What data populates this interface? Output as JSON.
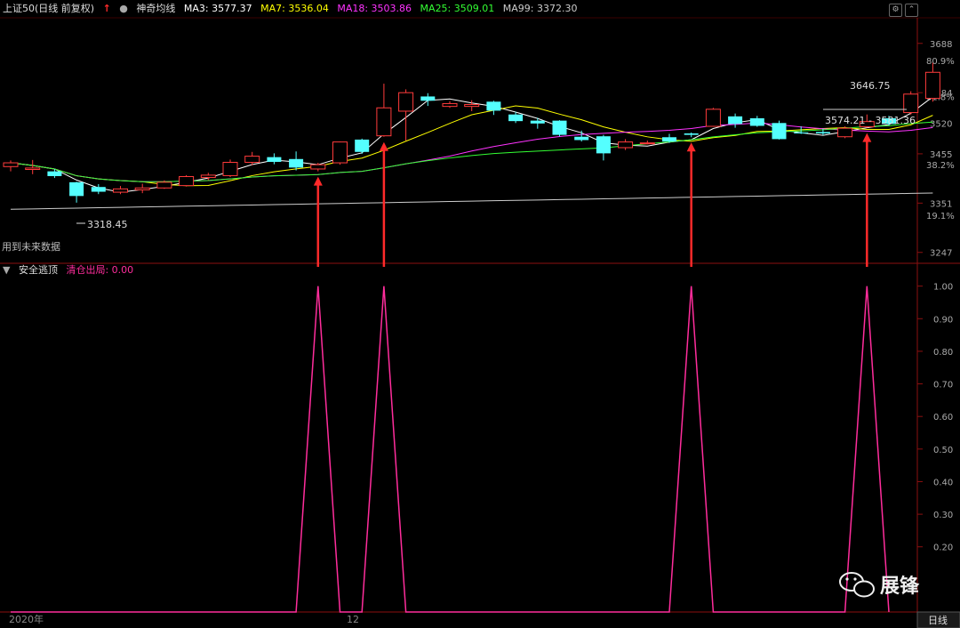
{
  "header": {
    "symbol": "上证50(日线 前复权)",
    "indicator": "神奇均线",
    "ma": [
      {
        "label": "MA3: 3577.37",
        "color": "#ffffff"
      },
      {
        "label": "MA7: 3536.04",
        "color": "#ffff00"
      },
      {
        "label": "MA18: 3503.86",
        "color": "#ff33ff"
      },
      {
        "label": "MA25: 3509.01",
        "color": "#33ff33"
      },
      {
        "label": "MA99: 3372.30",
        "color": "#cccccc"
      }
    ]
  },
  "sub_header": {
    "title": "安全逃顶",
    "series": "清仓出局: 0.00"
  },
  "footer": {
    "year": "2020年",
    "month": "12",
    "period": "日线"
  },
  "watermark": {
    "text": "展锋"
  },
  "annotations": {
    "future": "用到未来数据",
    "low": "3318.45",
    "high": "3646.75",
    "range": "3574.21 - 3581.36"
  },
  "chart_data": [
    {
      "type": "candlestick",
      "y_ticks": [
        "3688",
        "3584",
        "3520",
        "3455",
        "3351",
        "3247"
      ],
      "y_ticks_values": [
        3688,
        3584,
        3520,
        3455,
        3351,
        3247
      ],
      "pct_ticks": [
        "80.9%",
        "61.8%",
        "38.2%",
        "19.1%"
      ],
      "pct_values": [
        3651.8,
        3576.2,
        3432.7,
        3324.9
      ],
      "ylim": [
        3224,
        3742
      ],
      "candles": [
        [
          3428,
          3436,
          3418,
          3441
        ],
        [
          3422,
          3425,
          3412,
          3442
        ],
        [
          3418,
          3408,
          3404,
          3423
        ],
        [
          3395,
          3366,
          3352,
          3396
        ],
        [
          3385,
          3375,
          3370,
          3391
        ],
        [
          3374,
          3381,
          3370,
          3387
        ],
        [
          3379,
          3383,
          3372,
          3392
        ],
        [
          3383,
          3395,
          3381,
          3399
        ],
        [
          3388,
          3407,
          3386,
          3410
        ],
        [
          3405,
          3410,
          3399,
          3415
        ],
        [
          3409,
          3437,
          3406,
          3443
        ],
        [
          3437,
          3450,
          3431,
          3459
        ],
        [
          3448,
          3438,
          3433,
          3456
        ],
        [
          3444,
          3426,
          3420,
          3460
        ],
        [
          3423,
          3432,
          3418,
          3436
        ],
        [
          3436,
          3480,
          3432,
          3481
        ],
        [
          3485,
          3459,
          3455,
          3487
        ],
        [
          3493,
          3552,
          3491,
          3603
        ],
        [
          3545,
          3584,
          3483,
          3591
        ],
        [
          3576,
          3567,
          3556,
          3583
        ],
        [
          3555,
          3561,
          3552,
          3566
        ],
        [
          3555,
          3559,
          3545,
          3568
        ],
        [
          3565,
          3546,
          3537,
          3567
        ],
        [
          3538,
          3524,
          3520,
          3544
        ],
        [
          3525,
          3519,
          3508,
          3531
        ],
        [
          3525,
          3495,
          3492,
          3526
        ],
        [
          3491,
          3484,
          3481,
          3504
        ],
        [
          3492,
          3456,
          3441,
          3495
        ],
        [
          3468,
          3480,
          3463,
          3486
        ],
        [
          3478,
          3478,
          3475,
          3483
        ],
        [
          3490,
          3481,
          3478,
          3497
        ],
        [
          3498,
          3495,
          3490,
          3500
        ],
        [
          3513,
          3549,
          3512,
          3552
        ],
        [
          3534,
          3518,
          3510,
          3540
        ],
        [
          3530,
          3514,
          3512,
          3535
        ],
        [
          3520,
          3486,
          3485,
          3525
        ],
        [
          3500,
          3498,
          3497,
          3513
        ],
        [
          3501,
          3498,
          3494,
          3508
        ],
        [
          3491,
          3509,
          3488,
          3513
        ],
        [
          3512,
          3523,
          3510,
          3538
        ],
        [
          3530,
          3518,
          3515,
          3535
        ],
        [
          3542,
          3581,
          3538,
          3587
        ],
        [
          3572,
          3627,
          3565,
          3647
        ]
      ]
    },
    {
      "type": "line",
      "title": "安全逃顶",
      "series": [
        {
          "name": "清仓出局",
          "values": [
            0,
            0,
            0,
            0,
            0,
            0,
            0,
            0,
            0,
            0,
            0,
            0,
            0,
            0,
            1,
            0,
            0,
            1,
            0,
            0,
            0,
            0,
            0,
            0,
            0,
            0,
            0,
            0,
            0,
            0,
            0,
            1,
            0,
            0,
            0,
            0,
            0,
            0,
            0,
            1,
            0
          ]
        }
      ],
      "y_ticks": [
        "1.00",
        "0.90",
        "0.80",
        "0.70",
        "0.60",
        "0.50",
        "0.40",
        "0.30",
        "0.20"
      ],
      "y_ticks_values": [
        1.0,
        0.9,
        0.8,
        0.7,
        0.6,
        0.5,
        0.4,
        0.3,
        0.2
      ],
      "ylim": [
        0,
        1.07
      ],
      "peak_positions": [
        14,
        17,
        31,
        39
      ]
    }
  ]
}
